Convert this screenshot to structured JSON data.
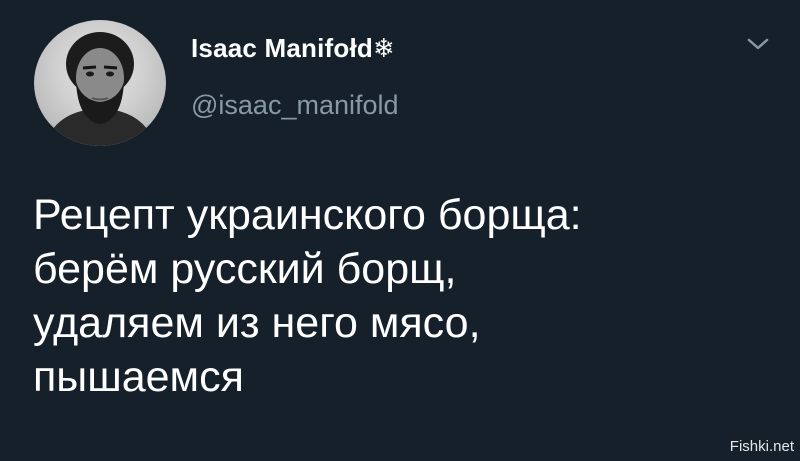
{
  "author": {
    "display_name": "Isaac Manifołd❄",
    "handle": "@isaac_manifold",
    "avatar_icon": "profile-photo"
  },
  "tweet": {
    "lines": [
      "Рецепт украинского борща:",
      "берём русский борщ,",
      "удаляем из него мясо,",
      "пышаемся"
    ]
  },
  "menu": {
    "icon": "chevron-down-icon"
  },
  "watermark": "Fishki.net",
  "colors": {
    "background": "#15202b",
    "text": "#ffffff",
    "secondary_text": "#8899a6"
  }
}
